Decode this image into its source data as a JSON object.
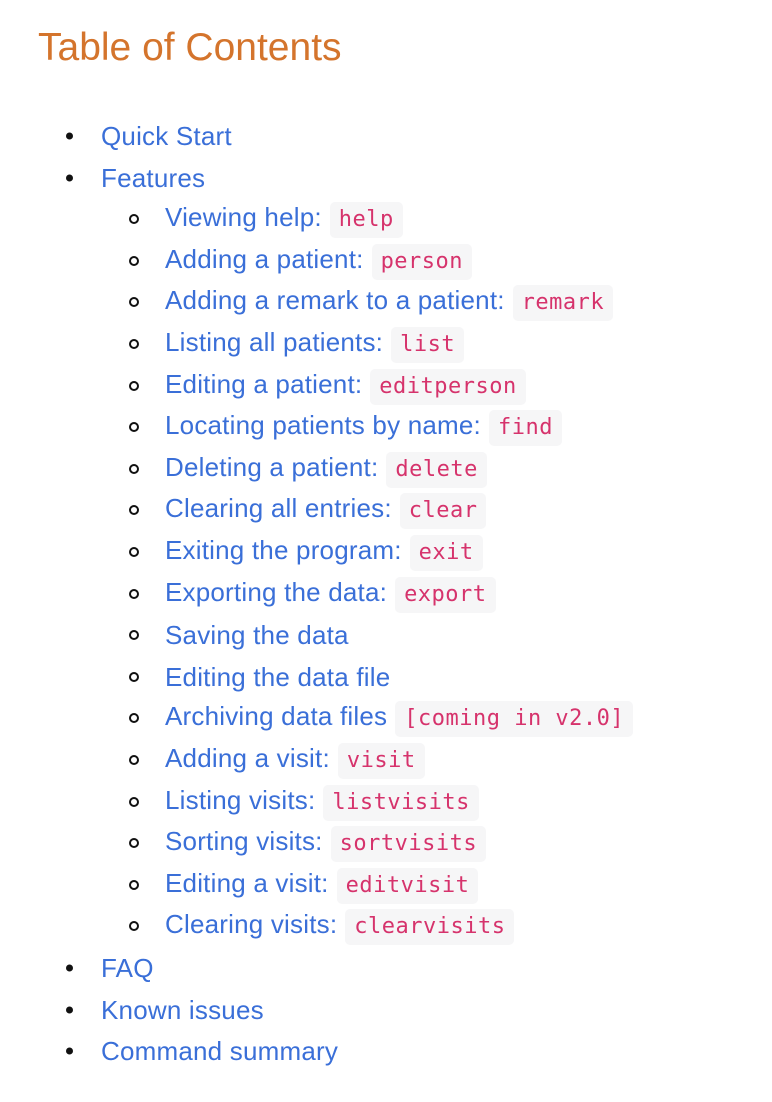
{
  "title": "Table of Contents",
  "toc": [
    {
      "level": 1,
      "label": "Quick Start",
      "code": null
    },
    {
      "level": 1,
      "label": "Features",
      "code": null
    },
    {
      "level": 2,
      "label": "Viewing help:",
      "code": "help"
    },
    {
      "level": 2,
      "label": "Adding a patient:",
      "code": "person"
    },
    {
      "level": 2,
      "label": "Adding a remark to a patient:",
      "code": "remark"
    },
    {
      "level": 2,
      "label": "Listing all patients:",
      "code": "list"
    },
    {
      "level": 2,
      "label": "Editing a patient:",
      "code": "editperson"
    },
    {
      "level": 2,
      "label": "Locating patients by name:",
      "code": "find"
    },
    {
      "level": 2,
      "label": "Deleting a patient:",
      "code": "delete"
    },
    {
      "level": 2,
      "label": "Clearing all entries:",
      "code": "clear"
    },
    {
      "level": 2,
      "label": "Exiting the program:",
      "code": "exit"
    },
    {
      "level": 2,
      "label": "Exporting the data:",
      "code": "export"
    },
    {
      "level": 2,
      "label": "Saving the data",
      "code": null
    },
    {
      "level": 2,
      "label": "Editing the data file",
      "code": null
    },
    {
      "level": 2,
      "label": "Archiving data files",
      "code": "[coming in v2.0]"
    },
    {
      "level": 2,
      "label": "Adding a visit:",
      "code": "visit"
    },
    {
      "level": 2,
      "label": "Listing visits:",
      "code": "listvisits"
    },
    {
      "level": 2,
      "label": "Sorting visits:",
      "code": "sortvisits"
    },
    {
      "level": 2,
      "label": "Editing a visit:",
      "code": "editvisit"
    },
    {
      "level": 2,
      "label": "Clearing visits:",
      "code": "clearvisits"
    },
    {
      "level": 1,
      "label": "FAQ",
      "code": null
    },
    {
      "level": 1,
      "label": "Known issues",
      "code": null
    },
    {
      "level": 1,
      "label": "Command summary",
      "code": null
    }
  ],
  "colors": {
    "title": "#d4742c",
    "link": "#3a6fd8",
    "code_text": "#d6336c",
    "code_background": "#f6f6f7",
    "bullet": "#111111"
  }
}
